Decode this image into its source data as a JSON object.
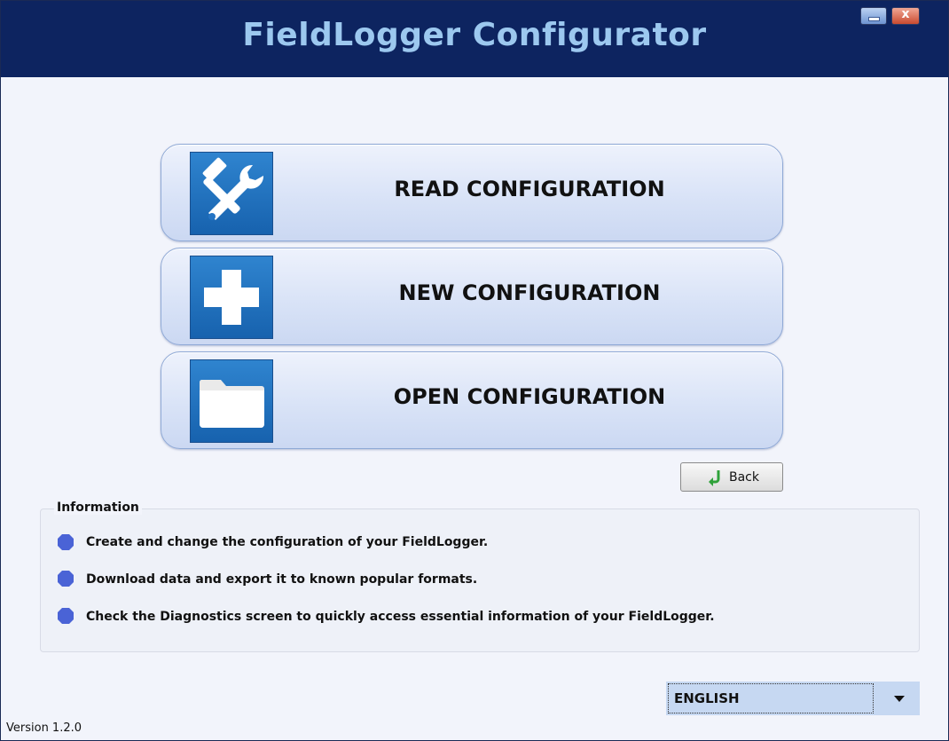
{
  "window": {
    "title": "FieldLogger Configurator",
    "controls": {
      "minimize_icon": "minimize-icon",
      "close_label": "x"
    }
  },
  "main_buttons": [
    {
      "label": "READ CONFIGURATION",
      "icon": "tools-icon"
    },
    {
      "label": "NEW CONFIGURATION",
      "icon": "plus-icon"
    },
    {
      "label": "OPEN CONFIGURATION",
      "icon": "folder-icon"
    }
  ],
  "back_button": {
    "label": "Back",
    "icon": "back-arrow-icon"
  },
  "info": {
    "title": "Information",
    "items": [
      "Create and change the configuration of your FieldLogger.",
      "Download data and export it to known popular formats.",
      "Check the Diagnostics screen to quickly access essential information of your FieldLogger."
    ]
  },
  "language": {
    "selected": "ENGLISH"
  },
  "version": "Version 1.2.0",
  "colors": {
    "titlebar": "#0d2460",
    "title_text": "#9cc8ef",
    "tile": "#1f6fbf",
    "bullet": "#4a63d6"
  }
}
